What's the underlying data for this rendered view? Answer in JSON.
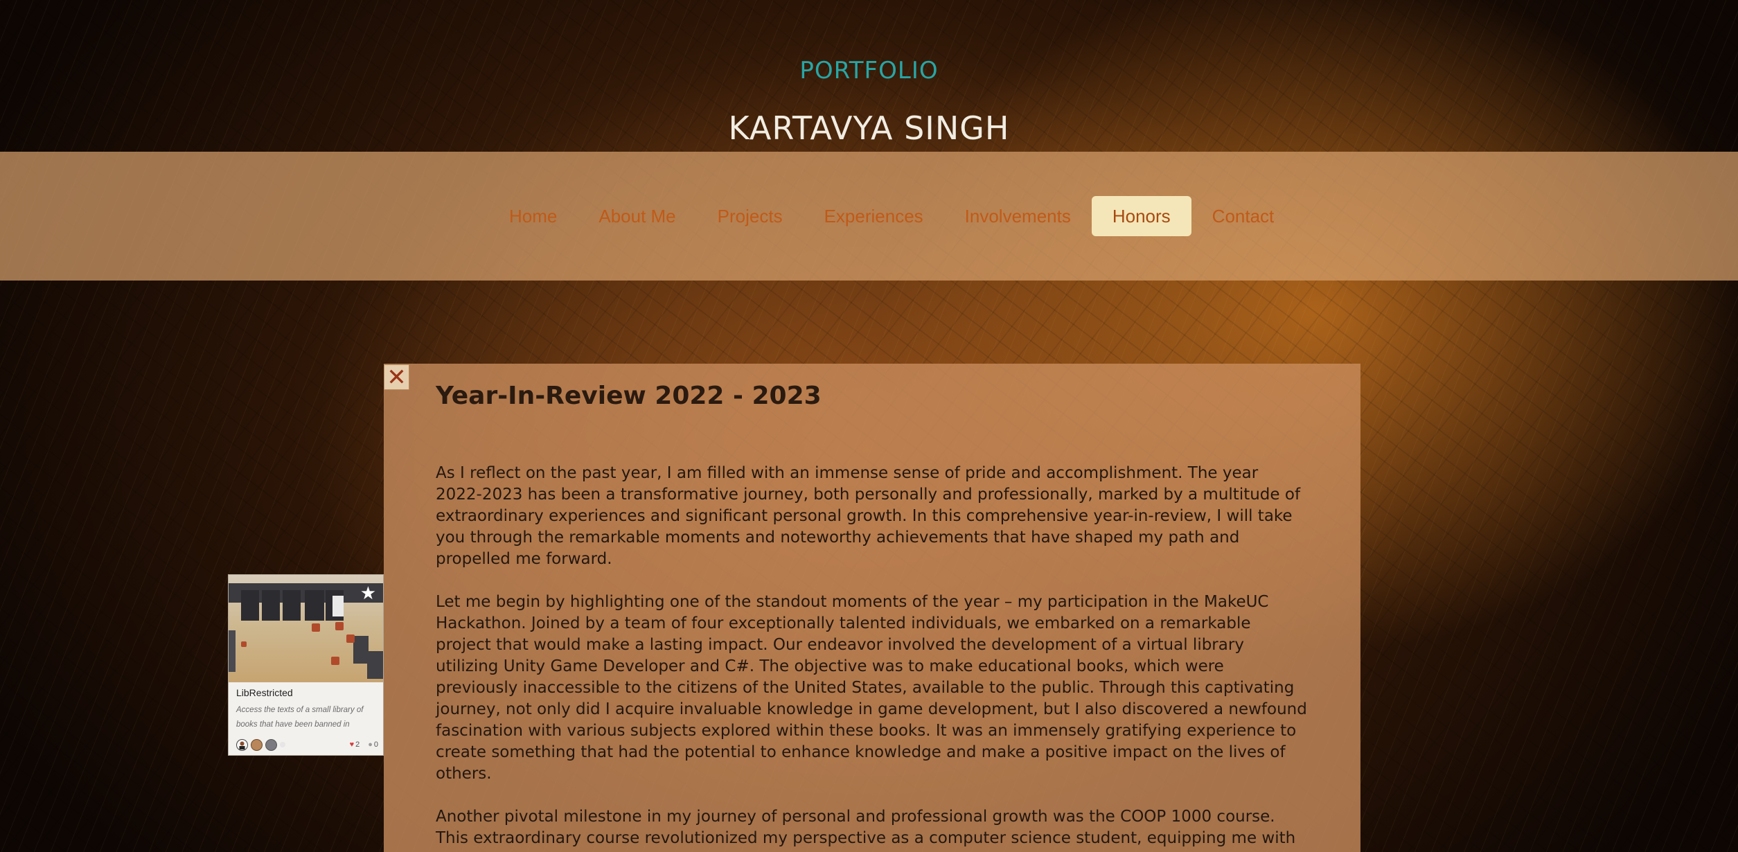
{
  "header": {
    "label": "PORTFOLIO",
    "name": "KARTAVYA SINGH"
  },
  "nav": {
    "items": [
      {
        "label": "Home"
      },
      {
        "label": "About Me"
      },
      {
        "label": "Projects"
      },
      {
        "label": "Experiences"
      },
      {
        "label": "Involvements"
      },
      {
        "label": "Honors",
        "active": true
      },
      {
        "label": "Contact"
      }
    ]
  },
  "modal": {
    "close_icon": "close-icon",
    "title": "Year-In-Review 2022 - 2023",
    "paragraphs": [
      "As I reflect on the past year, I am filled with an immense sense of pride and accomplishment. The year 2022-2023 has been a transformative journey, both personally and professionally, marked by a multitude of extraordinary experiences and significant personal growth. In this comprehensive year-in-review, I will take you through the remarkable moments and noteworthy achievements that have shaped my path and propelled me forward.",
      "Let me begin by highlighting one of the standout moments of the year – my participation in the MakeUC Hackathon. Joined by a team of four exceptionally talented individuals, we embarked on a remarkable project that would make a lasting impact. Our endeavor involved the development of a virtual library utilizing Unity Game Developer and C#. The objective was to make educational books, which were previously inaccessible to the citizens of the United States, available to the public. Through this captivating journey, not only did I acquire invaluable knowledge in game development, but I also discovered a newfound fascination with various subjects explored within these books. It was an immensely gratifying experience to create something that had the potential to enhance knowledge and make a positive impact on the lives of others.",
      "Another pivotal milestone in my journey of personal and professional growth was the COOP 1000 course. This extraordinary course revolutionized my perspective as a computer science student, equipping me with"
    ]
  },
  "project_card": {
    "title": "LibRestricted",
    "description": "Access the texts of a small library of books that have been banned in",
    "likes": "2",
    "comments": "0",
    "star_icon": "star-icon"
  },
  "colors": {
    "accent_teal": "#27a6a6",
    "nav_text": "#c05a18",
    "nav_active_bg": "#f4e6b8"
  }
}
